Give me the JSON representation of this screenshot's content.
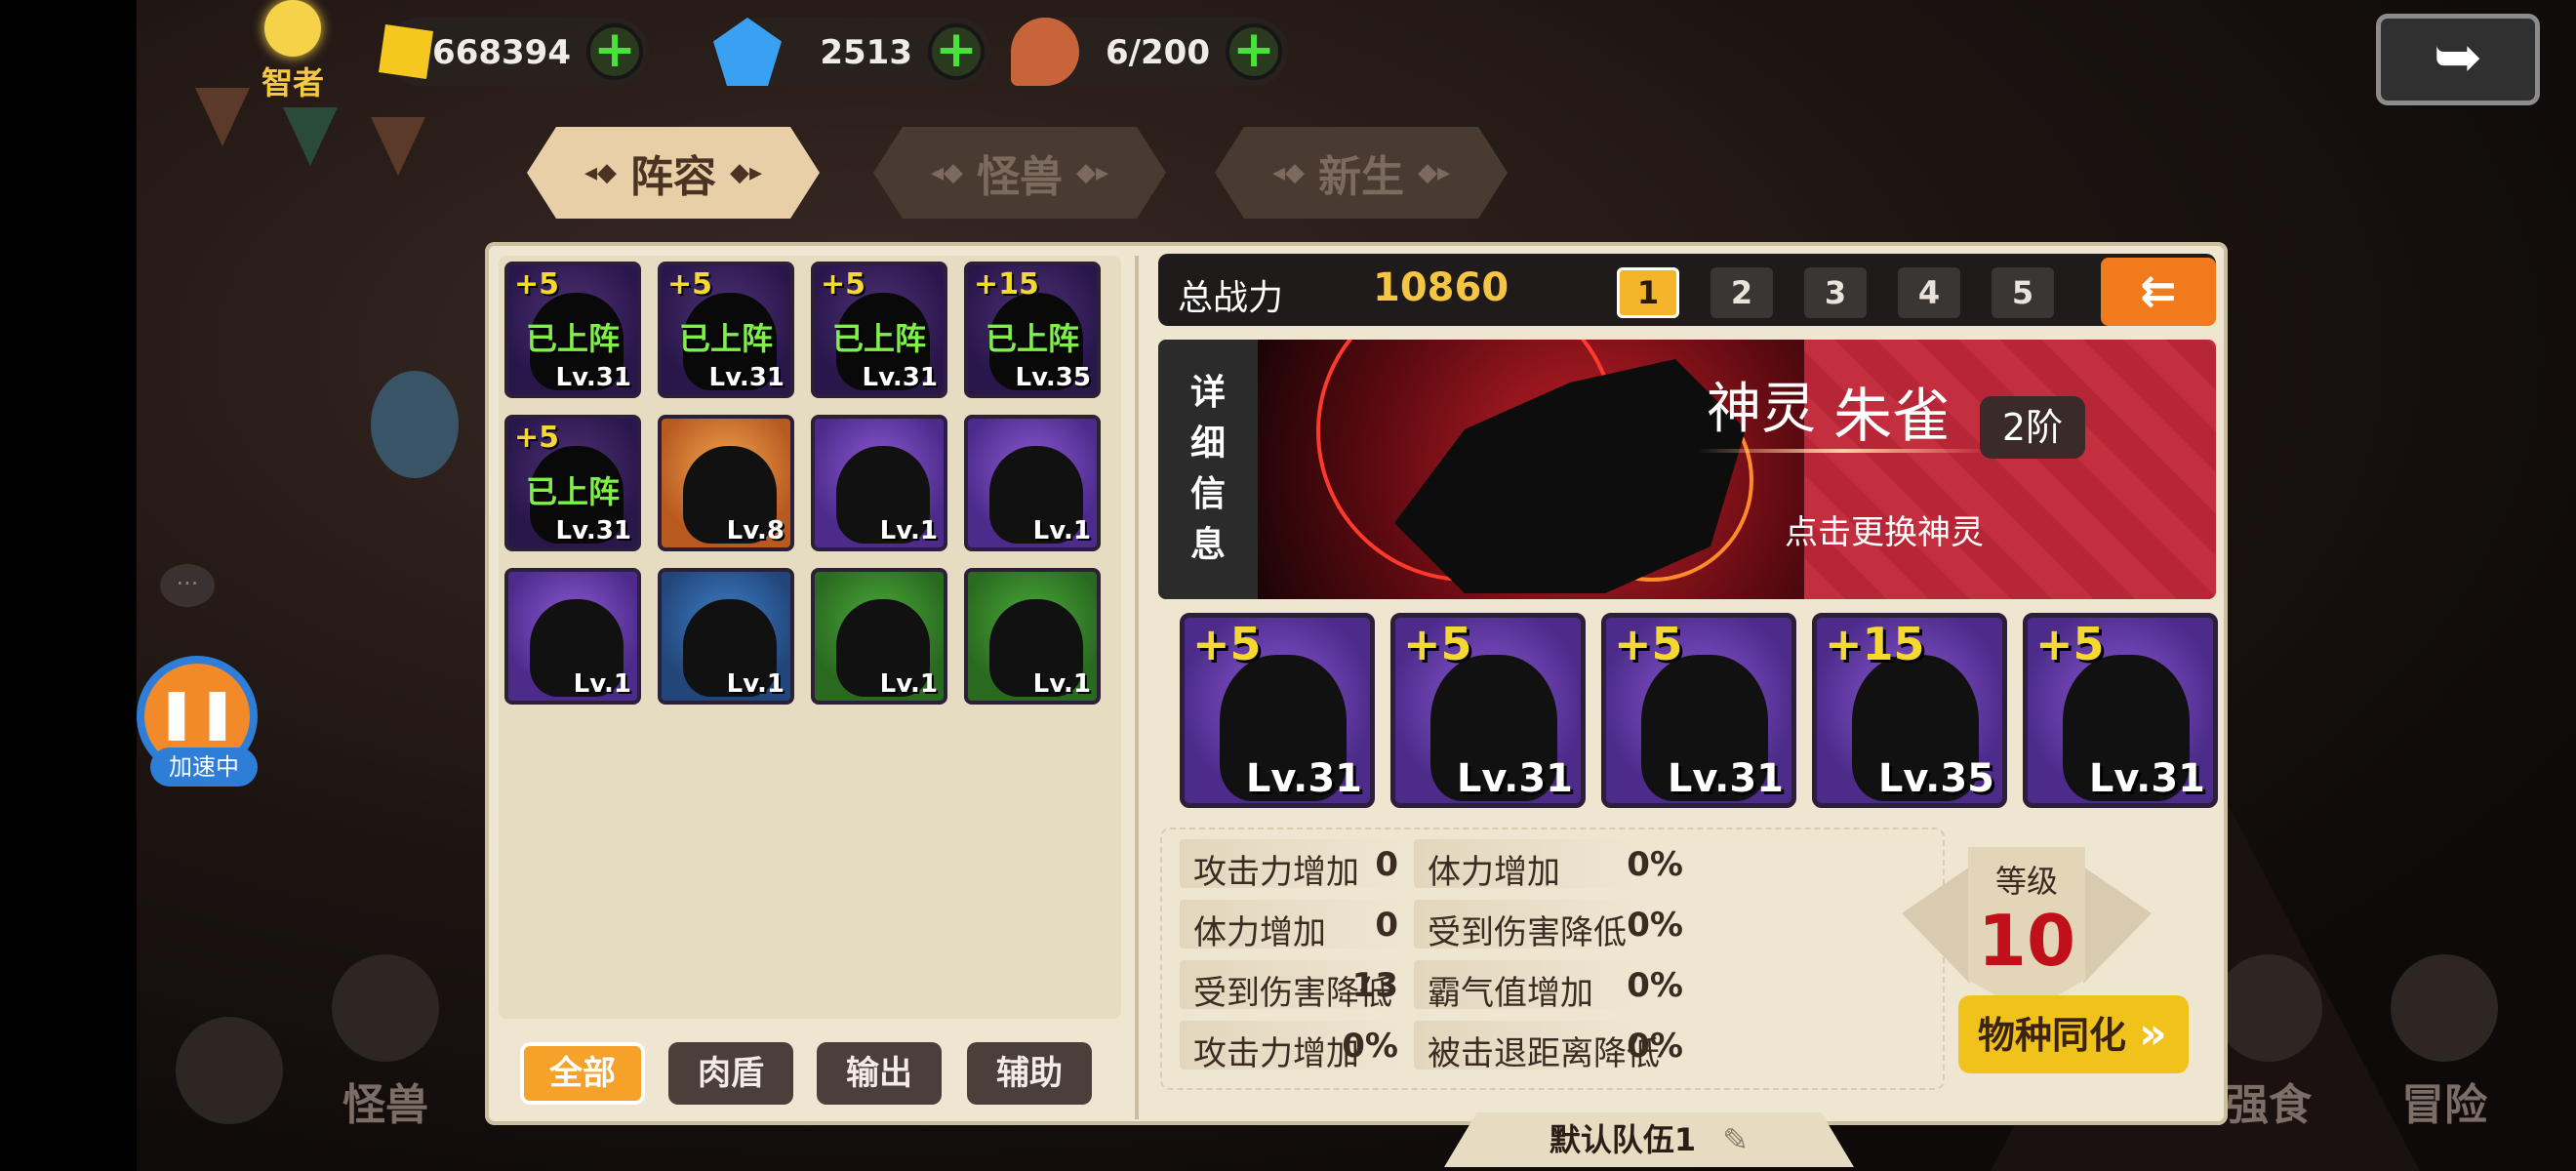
{
  "topbar": {
    "sage_label": "智者",
    "gold": "668394",
    "gems": "2513",
    "stamina": "6/200",
    "back_label": "➥"
  },
  "tabs": [
    {
      "label": "阵容",
      "active": true
    },
    {
      "label": "怪兽",
      "active": false
    },
    {
      "label": "新生",
      "active": false
    }
  ],
  "roster": [
    {
      "plus": "+5",
      "level": "Lv.31",
      "status": "已上阵",
      "frame": "purple"
    },
    {
      "plus": "+5",
      "level": "Lv.31",
      "status": "已上阵",
      "frame": "purple"
    },
    {
      "plus": "+5",
      "level": "Lv.31",
      "status": "已上阵",
      "frame": "purple"
    },
    {
      "plus": "+15",
      "level": "Lv.35",
      "status": "已上阵",
      "frame": "purple"
    },
    {
      "plus": "+5",
      "level": "Lv.31",
      "status": "已上阵",
      "frame": "purple"
    },
    {
      "plus": "",
      "level": "Lv.8",
      "status": "",
      "frame": "orange"
    },
    {
      "plus": "",
      "level": "Lv.1",
      "status": "",
      "frame": "purple"
    },
    {
      "plus": "",
      "level": "Lv.1",
      "status": "",
      "frame": "purple"
    },
    {
      "plus": "",
      "level": "Lv.1",
      "status": "",
      "frame": "purple"
    },
    {
      "plus": "",
      "level": "Lv.1",
      "status": "",
      "frame": "blue"
    },
    {
      "plus": "",
      "level": "Lv.1",
      "status": "",
      "frame": "green"
    },
    {
      "plus": "",
      "level": "Lv.1",
      "status": "",
      "frame": "green"
    }
  ],
  "filters": [
    {
      "label": "全部",
      "active": true
    },
    {
      "label": "肉盾",
      "active": false
    },
    {
      "label": "输出",
      "active": false
    },
    {
      "label": "辅助",
      "active": false
    }
  ],
  "power": {
    "label": "总战力",
    "value": "10860"
  },
  "team_numbers": [
    "1",
    "2",
    "3",
    "4",
    "5"
  ],
  "active_team": "1",
  "spirit": {
    "detail_label": [
      "详",
      "细",
      "信",
      "息"
    ],
    "type": "神灵",
    "name": "朱雀",
    "rank": "2阶",
    "tip": "点击更换神灵"
  },
  "team": [
    {
      "plus": "+5",
      "level": "Lv.31"
    },
    {
      "plus": "+5",
      "level": "Lv.31"
    },
    {
      "plus": "+5",
      "level": "Lv.31"
    },
    {
      "plus": "+15",
      "level": "Lv.35"
    },
    {
      "plus": "+5",
      "level": "Lv.31"
    }
  ],
  "stats": [
    {
      "label": "攻击力增加",
      "value": "0"
    },
    {
      "label": "体力增加",
      "value": "0%"
    },
    {
      "label": "体力增加",
      "value": "0"
    },
    {
      "label": "受到伤害降低",
      "value": "0%"
    },
    {
      "label": "受到伤害降低",
      "value": "13"
    },
    {
      "label": "霸气值增加",
      "value": "0%"
    },
    {
      "label": "攻击力增加",
      "value": "0%"
    },
    {
      "label": "被击退距离降低",
      "value": "0%"
    }
  ],
  "level": {
    "label": "等级",
    "value": "10"
  },
  "assimilate_label": "物种同化",
  "team_name": "默认队伍1",
  "speed": {
    "label": "加速中"
  },
  "bottom_nav": [
    {
      "label": "怪兽"
    },
    {
      "label": "强食"
    },
    {
      "label": "冒险"
    }
  ]
}
